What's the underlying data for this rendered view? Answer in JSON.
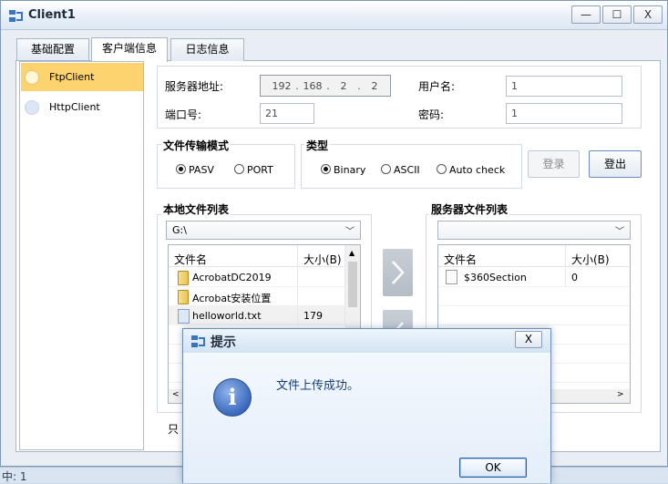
{
  "window": {
    "title": "Client1",
    "minimize": "—",
    "maximize": "☐",
    "close": "X"
  },
  "tabs": [
    {
      "label": "基础配置",
      "active": false
    },
    {
      "label": "客户端信息",
      "active": true
    },
    {
      "label": "日志信息",
      "active": false
    }
  ],
  "clients": [
    {
      "label": "FtpClient",
      "selected": true
    },
    {
      "label": "HttpClient",
      "selected": false
    }
  ],
  "server": {
    "address_label": "服务器地址:",
    "ip": [
      "192",
      "168",
      "2",
      "2"
    ],
    "port_label": "端口号:",
    "port": "21",
    "username_label": "用户名:",
    "username": "1",
    "password_label": "密码:",
    "password": "1"
  },
  "transfer_mode": {
    "title": "文件传输模式",
    "options": [
      "PASV",
      "PORT"
    ],
    "selected": "PASV"
  },
  "type": {
    "title": "类型",
    "options": [
      "Binary",
      "ASCII",
      "Auto check"
    ],
    "selected": "Binary"
  },
  "buttons": {
    "login": "登录",
    "logout": "登出"
  },
  "local": {
    "title": "本地文件列表",
    "drive": "G:\\",
    "col_name": "文件名",
    "col_size": "大小(B)",
    "files": [
      {
        "name": "AcrobatDC2019",
        "size": "",
        "kind": "folder"
      },
      {
        "name": "Acrobat安装位置",
        "size": "",
        "kind": "folder"
      },
      {
        "name": "helloworld.txt",
        "size": "179",
        "kind": "file"
      }
    ],
    "footer": "只"
  },
  "remote": {
    "title": "服务器文件列表",
    "drive": "",
    "col_name": "文件名",
    "col_size": "大小(B)",
    "files": [
      {
        "name": "$360Section",
        "size": "0",
        "kind": "plain"
      }
    ]
  },
  "statusbar": {
    "text": "中: 1"
  },
  "dialog": {
    "title": "提示",
    "close": "X",
    "message": "文件上传成功。",
    "ok": "OK"
  },
  "colors": {
    "selected_client": "#fcd36f",
    "dialog_text": "#1a3d7a"
  }
}
